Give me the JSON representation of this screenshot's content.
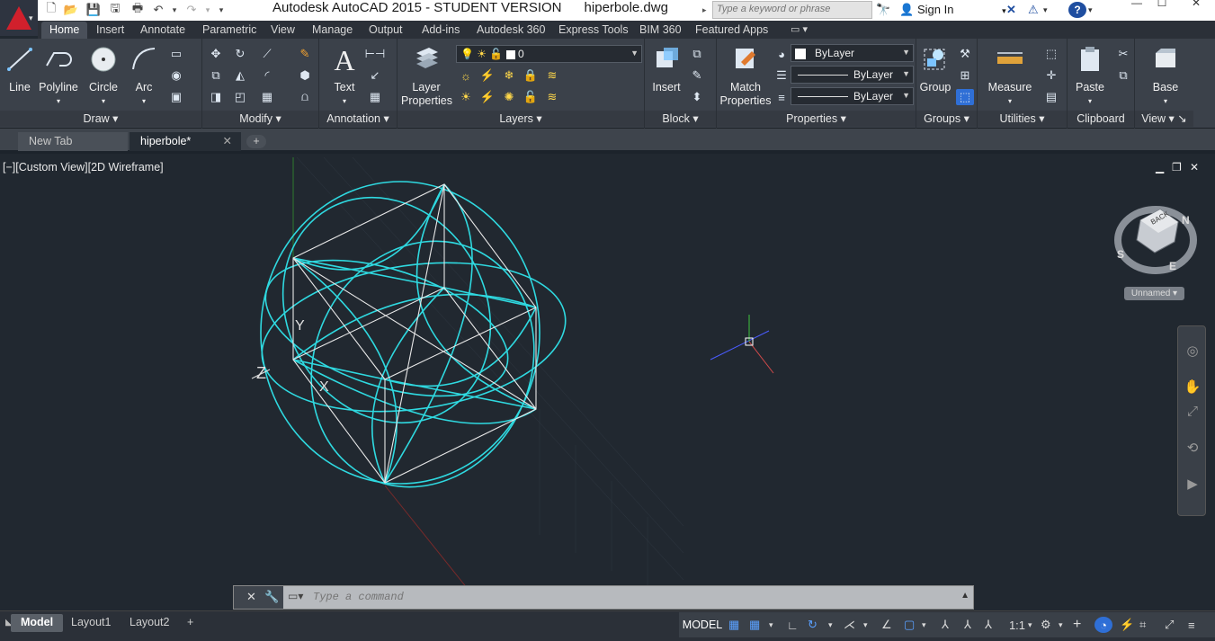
{
  "window": {
    "title": "Autodesk AutoCAD 2015 - STUDENT VERSION",
    "filename": "hiperbole.dwg",
    "search_placeholder": "Type a keyword or phrase",
    "sign_in": "Sign In"
  },
  "ribbon_tabs": [
    "Home",
    "Insert",
    "Annotate",
    "Parametric",
    "View",
    "Manage",
    "Output",
    "Add-ins",
    "Autodesk 360",
    "Express Tools",
    "BIM 360",
    "Featured Apps"
  ],
  "ribbon": {
    "draw": {
      "title": "Draw",
      "line": "Line",
      "polyline": "Polyline",
      "circle": "Circle",
      "arc": "Arc"
    },
    "modify": {
      "title": "Modify"
    },
    "annotation": {
      "title": "Annotation",
      "text": "Text"
    },
    "layers": {
      "title": "Layers",
      "layer_properties_1": "Layer",
      "layer_properties_2": "Properties",
      "current_layer": "0"
    },
    "block": {
      "title": "Block",
      "insert": "Insert"
    },
    "properties": {
      "title": "Properties",
      "match_1": "Match",
      "match_2": "Properties",
      "color": "ByLayer",
      "linetype": "ByLayer",
      "lineweight": "ByLayer"
    },
    "groups": {
      "title": "Groups",
      "group": "Group"
    },
    "utilities": {
      "title": "Utilities",
      "measure": "Measure"
    },
    "clipboard": {
      "title": "Clipboard",
      "paste": "Paste"
    },
    "view": {
      "title": "View",
      "base": "Base"
    }
  },
  "doc_tabs": {
    "new_tab": "New Tab",
    "current": "hiperbole*"
  },
  "viewport": {
    "label": "[−][Custom View][2D Wireframe]",
    "named_view": "Unnamed",
    "viewcube_faces": {
      "top": "BACK",
      "n": "N",
      "s": "S",
      "e": "E"
    },
    "axis_labels": {
      "x": "X",
      "y": "Y",
      "z": "Z"
    }
  },
  "command": {
    "placeholder": "Type a command"
  },
  "layout_tabs": [
    "Model",
    "Layout1",
    "Layout2"
  ],
  "status": {
    "model": "MODEL",
    "scale": "1:1"
  },
  "colors": {
    "geometry": "#2fd9e0",
    "edges": "#e8e8e8",
    "accent": "#2f6fd6",
    "background": "#212830"
  }
}
